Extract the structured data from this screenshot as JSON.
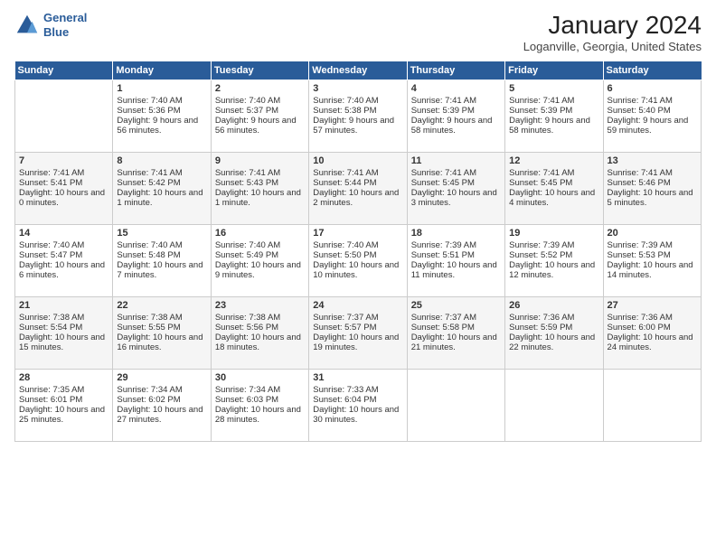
{
  "header": {
    "logo_line1": "General",
    "logo_line2": "Blue",
    "title": "January 2024",
    "location": "Loganville, Georgia, United States"
  },
  "days_of_week": [
    "Sunday",
    "Monday",
    "Tuesday",
    "Wednesday",
    "Thursday",
    "Friday",
    "Saturday"
  ],
  "weeks": [
    [
      {
        "day": "",
        "empty": true
      },
      {
        "day": "1",
        "sunrise": "Sunrise: 7:40 AM",
        "sunset": "Sunset: 5:36 PM",
        "daylight": "Daylight: 9 hours and 56 minutes."
      },
      {
        "day": "2",
        "sunrise": "Sunrise: 7:40 AM",
        "sunset": "Sunset: 5:37 PM",
        "daylight": "Daylight: 9 hours and 56 minutes."
      },
      {
        "day": "3",
        "sunrise": "Sunrise: 7:40 AM",
        "sunset": "Sunset: 5:38 PM",
        "daylight": "Daylight: 9 hours and 57 minutes."
      },
      {
        "day": "4",
        "sunrise": "Sunrise: 7:41 AM",
        "sunset": "Sunset: 5:39 PM",
        "daylight": "Daylight: 9 hours and 58 minutes."
      },
      {
        "day": "5",
        "sunrise": "Sunrise: 7:41 AM",
        "sunset": "Sunset: 5:39 PM",
        "daylight": "Daylight: 9 hours and 58 minutes."
      },
      {
        "day": "6",
        "sunrise": "Sunrise: 7:41 AM",
        "sunset": "Sunset: 5:40 PM",
        "daylight": "Daylight: 9 hours and 59 minutes."
      }
    ],
    [
      {
        "day": "7",
        "sunrise": "Sunrise: 7:41 AM",
        "sunset": "Sunset: 5:41 PM",
        "daylight": "Daylight: 10 hours and 0 minutes."
      },
      {
        "day": "8",
        "sunrise": "Sunrise: 7:41 AM",
        "sunset": "Sunset: 5:42 PM",
        "daylight": "Daylight: 10 hours and 1 minute."
      },
      {
        "day": "9",
        "sunrise": "Sunrise: 7:41 AM",
        "sunset": "Sunset: 5:43 PM",
        "daylight": "Daylight: 10 hours and 1 minute."
      },
      {
        "day": "10",
        "sunrise": "Sunrise: 7:41 AM",
        "sunset": "Sunset: 5:44 PM",
        "daylight": "Daylight: 10 hours and 2 minutes."
      },
      {
        "day": "11",
        "sunrise": "Sunrise: 7:41 AM",
        "sunset": "Sunset: 5:45 PM",
        "daylight": "Daylight: 10 hours and 3 minutes."
      },
      {
        "day": "12",
        "sunrise": "Sunrise: 7:41 AM",
        "sunset": "Sunset: 5:45 PM",
        "daylight": "Daylight: 10 hours and 4 minutes."
      },
      {
        "day": "13",
        "sunrise": "Sunrise: 7:41 AM",
        "sunset": "Sunset: 5:46 PM",
        "daylight": "Daylight: 10 hours and 5 minutes."
      }
    ],
    [
      {
        "day": "14",
        "sunrise": "Sunrise: 7:40 AM",
        "sunset": "Sunset: 5:47 PM",
        "daylight": "Daylight: 10 hours and 6 minutes."
      },
      {
        "day": "15",
        "sunrise": "Sunrise: 7:40 AM",
        "sunset": "Sunset: 5:48 PM",
        "daylight": "Daylight: 10 hours and 7 minutes."
      },
      {
        "day": "16",
        "sunrise": "Sunrise: 7:40 AM",
        "sunset": "Sunset: 5:49 PM",
        "daylight": "Daylight: 10 hours and 9 minutes."
      },
      {
        "day": "17",
        "sunrise": "Sunrise: 7:40 AM",
        "sunset": "Sunset: 5:50 PM",
        "daylight": "Daylight: 10 hours and 10 minutes."
      },
      {
        "day": "18",
        "sunrise": "Sunrise: 7:39 AM",
        "sunset": "Sunset: 5:51 PM",
        "daylight": "Daylight: 10 hours and 11 minutes."
      },
      {
        "day": "19",
        "sunrise": "Sunrise: 7:39 AM",
        "sunset": "Sunset: 5:52 PM",
        "daylight": "Daylight: 10 hours and 12 minutes."
      },
      {
        "day": "20",
        "sunrise": "Sunrise: 7:39 AM",
        "sunset": "Sunset: 5:53 PM",
        "daylight": "Daylight: 10 hours and 14 minutes."
      }
    ],
    [
      {
        "day": "21",
        "sunrise": "Sunrise: 7:38 AM",
        "sunset": "Sunset: 5:54 PM",
        "daylight": "Daylight: 10 hours and 15 minutes."
      },
      {
        "day": "22",
        "sunrise": "Sunrise: 7:38 AM",
        "sunset": "Sunset: 5:55 PM",
        "daylight": "Daylight: 10 hours and 16 minutes."
      },
      {
        "day": "23",
        "sunrise": "Sunrise: 7:38 AM",
        "sunset": "Sunset: 5:56 PM",
        "daylight": "Daylight: 10 hours and 18 minutes."
      },
      {
        "day": "24",
        "sunrise": "Sunrise: 7:37 AM",
        "sunset": "Sunset: 5:57 PM",
        "daylight": "Daylight: 10 hours and 19 minutes."
      },
      {
        "day": "25",
        "sunrise": "Sunrise: 7:37 AM",
        "sunset": "Sunset: 5:58 PM",
        "daylight": "Daylight: 10 hours and 21 minutes."
      },
      {
        "day": "26",
        "sunrise": "Sunrise: 7:36 AM",
        "sunset": "Sunset: 5:59 PM",
        "daylight": "Daylight: 10 hours and 22 minutes."
      },
      {
        "day": "27",
        "sunrise": "Sunrise: 7:36 AM",
        "sunset": "Sunset: 6:00 PM",
        "daylight": "Daylight: 10 hours and 24 minutes."
      }
    ],
    [
      {
        "day": "28",
        "sunrise": "Sunrise: 7:35 AM",
        "sunset": "Sunset: 6:01 PM",
        "daylight": "Daylight: 10 hours and 25 minutes."
      },
      {
        "day": "29",
        "sunrise": "Sunrise: 7:34 AM",
        "sunset": "Sunset: 6:02 PM",
        "daylight": "Daylight: 10 hours and 27 minutes."
      },
      {
        "day": "30",
        "sunrise": "Sunrise: 7:34 AM",
        "sunset": "Sunset: 6:03 PM",
        "daylight": "Daylight: 10 hours and 28 minutes."
      },
      {
        "day": "31",
        "sunrise": "Sunrise: 7:33 AM",
        "sunset": "Sunset: 6:04 PM",
        "daylight": "Daylight: 10 hours and 30 minutes."
      },
      {
        "day": "",
        "empty": true
      },
      {
        "day": "",
        "empty": true
      },
      {
        "day": "",
        "empty": true
      }
    ]
  ]
}
